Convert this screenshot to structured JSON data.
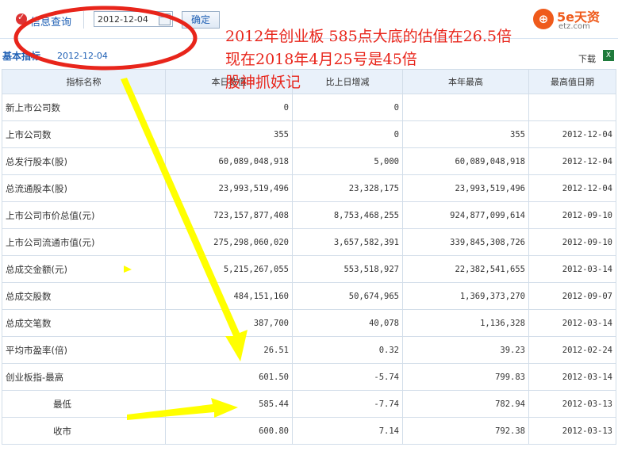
{
  "toolbar": {
    "query_label": "信息查询",
    "date_value": "2012-12-04",
    "ok_label": "确定"
  },
  "logo": {
    "brand": "5e天资",
    "url": "etz.com"
  },
  "section": {
    "title": "基本指标",
    "date": "2012-12-04",
    "download_label": "下载"
  },
  "table": {
    "headers": [
      "指标名称",
      "本日数值",
      "比上日增减",
      "本年最高",
      "最高值日期"
    ],
    "rows": [
      [
        "新上市公司数",
        "0",
        "0",
        "",
        ""
      ],
      [
        "上市公司数",
        "355",
        "0",
        "355",
        "2012-12-04"
      ],
      [
        "总发行股本(股)",
        "60,089,048,918",
        "5,000",
        "60,089,048,918",
        "2012-12-04"
      ],
      [
        "总流通股本(股)",
        "23,993,519,496",
        "23,328,175",
        "23,993,519,496",
        "2012-12-04"
      ],
      [
        "上市公司市价总值(元)",
        "723,157,877,408",
        "8,753,468,255",
        "924,877,099,614",
        "2012-09-10"
      ],
      [
        "上市公司流通市值(元)",
        "275,298,060,020",
        "3,657,582,391",
        "339,845,308,726",
        "2012-09-10"
      ],
      [
        "总成交金额(元)",
        "5,215,267,055",
        "553,518,927",
        "22,382,541,655",
        "2012-03-14"
      ],
      [
        "总成交股数",
        "484,151,160",
        "50,674,965",
        "1,369,373,270",
        "2012-09-07"
      ],
      [
        "总成交笔数",
        "387,700",
        "40,078",
        "1,136,328",
        "2012-03-14"
      ],
      [
        "平均市盈率(倍)",
        "26.51",
        "0.32",
        "39.23",
        "2012-02-24"
      ],
      [
        "创业板指-最高",
        "601.50",
        "-5.74",
        "799.83",
        "2012-03-14"
      ],
      [
        "最低",
        "585.44",
        "-7.74",
        "782.94",
        "2012-03-13"
      ],
      [
        "收市",
        "600.80",
        "7.14",
        "792.38",
        "2012-03-13"
      ]
    ]
  },
  "annotation": {
    "line1": "2012年创业板  585点大底的估值在26.5倍",
    "line2": "现在2018年4月25号是45倍",
    "line3": "股神抓妖记",
    "color": "#e8251b"
  },
  "colors": {
    "link": "#1e5fb4",
    "arrow": "#ffff00",
    "circle": "#e8251b",
    "header_bg": "#e9f1fa"
  }
}
